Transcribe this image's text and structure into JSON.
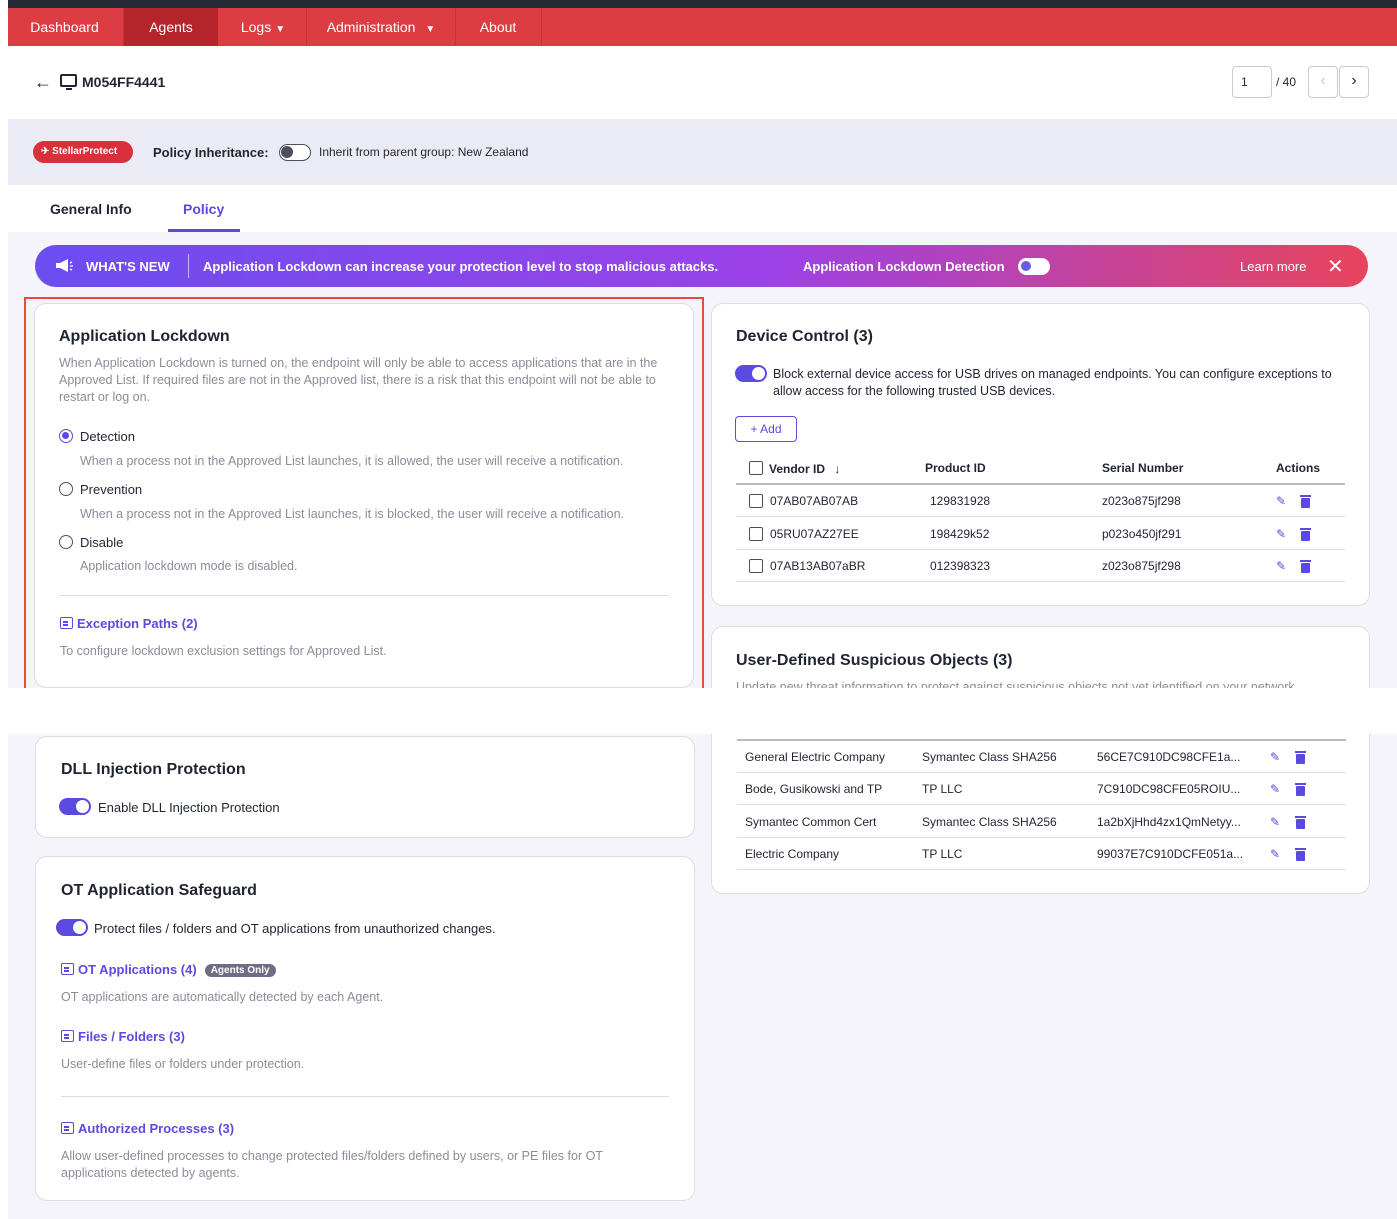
{
  "nav": {
    "items": [
      {
        "label": "Dashboard"
      },
      {
        "label": "Agents"
      },
      {
        "label": "Logs"
      },
      {
        "label": "Administration"
      },
      {
        "label": "About"
      }
    ]
  },
  "header": {
    "device_name": "M054FF4441",
    "page_current": "1",
    "page_total": "/ 40"
  },
  "policy_bar": {
    "brand": "StellarProtect",
    "inheritance_label": "Policy Inheritance:",
    "inherit_text": "Inherit from parent group:  New Zealand"
  },
  "tabs": [
    {
      "label": "General Info"
    },
    {
      "label": "Policy"
    }
  ],
  "banner": {
    "tag": "WHAT'S NEW",
    "message": "Application Lockdown can increase your protection level to stop malicious attacks.",
    "detection_label": "Application Lockdown Detection",
    "learn_more": "Learn more"
  },
  "lockdown": {
    "title": "Application Lockdown",
    "description": "When Application Lockdown is turned on, the endpoint will only be able to access applications that are in the Approved List. If required files are not in the Approved list, there is a risk that this endpoint will not be able to restart or log on.",
    "options": [
      {
        "label": "Detection",
        "desc": "When a process not in the Approved List launches, it is allowed, the user will receive a notification."
      },
      {
        "label": "Prevention",
        "desc": "When a process not in the Approved List launches, it is blocked, the user will receive a notification."
      },
      {
        "label": "Disable",
        "desc": "Application lockdown mode is disabled."
      }
    ],
    "selected": "Detection",
    "exception_link": "Exception Paths (2)",
    "exception_desc": "To configure lockdown exclusion settings for Approved List."
  },
  "dll": {
    "title": "DLL Injection Protection",
    "toggle_label": "Enable DLL Injection Protection"
  },
  "ot": {
    "title": "OT Application Safeguard",
    "toggle_label": "Protect files / folders and OT applications from unauthorized changes.",
    "apps_link": "OT Applications (4)",
    "apps_badge": "Agents Only",
    "apps_desc": "OT applications are automatically detected by each Agent.",
    "files_link": "Files / Folders (3)",
    "files_desc": "User-define files or folders under protection.",
    "processes_link": "Authorized Processes (3)",
    "processes_desc": "Allow user-defined processes to change protected files/folders defined by users, or PE files for OT applications detected by agents."
  },
  "device_control": {
    "title": "Device Control (3)",
    "toggle_text": "Block external device access for USB drives on managed endpoints. You can configure exceptions to allow access for the following trusted USB devices.",
    "add_label": "+ Add",
    "columns": [
      "Vendor ID",
      "Product ID",
      "Serial Number",
      "Actions"
    ],
    "rows": [
      [
        "07AB07AB07AB",
        "129831928",
        "z023o875jf298"
      ],
      [
        "05RU07AZ27EE",
        "198429k52",
        "p023o450jf291"
      ],
      [
        "07AB13AB07aBR",
        "012398323",
        "z023o875jf298"
      ]
    ]
  },
  "suspicious": {
    "title": "User-Defined Suspicious Objects (3)",
    "description": "Update new threat information to protect against suspicious objects not yet identified on your network.",
    "rows": [
      [
        "General Electric Company",
        "Symantec Class SHA256",
        "56CE7C910DC98CFE1a..."
      ],
      [
        "Bode, Gusikowski and TP",
        "TP LLC",
        "7C910DC98CFE05ROIU..."
      ],
      [
        "Symantec Common Cert",
        "Symantec Class SHA256",
        "1a2bXjHhd4zx1QmNetyy..."
      ],
      [
        "Electric Company",
        "TP LLC",
        "99037E7C910DCFE051a..."
      ]
    ]
  },
  "colors": {
    "nav_red": "#dc3d43",
    "accent_purple": "#5a4ae0",
    "highlight_red": "#e24d3c"
  }
}
